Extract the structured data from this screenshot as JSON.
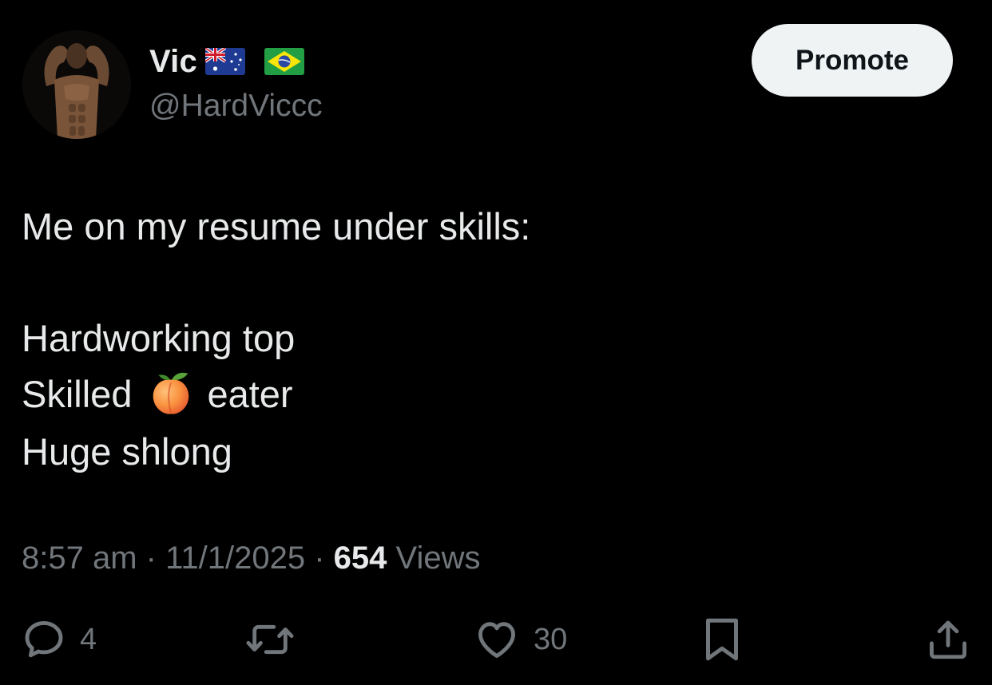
{
  "author": {
    "display_name": "Vic",
    "handle": "@HardViccc",
    "flags": [
      "australia-flag-icon",
      "brazil-flag-icon"
    ],
    "avatar": "profile-photo"
  },
  "promote_label": "Promote",
  "tweet": {
    "lines": [
      "Me on my resume under skills:",
      "Hardworking top",
      "Skilled",
      "eater",
      "Huge shlong"
    ],
    "inline_emoji": "peach-emoji-icon"
  },
  "meta": {
    "time": "8:57 am",
    "separator": "·",
    "date": "11/1/2025",
    "views_count": "654",
    "views_label": "Views"
  },
  "actions": {
    "replies": {
      "icon": "reply-icon",
      "count": "4"
    },
    "reposts": {
      "icon": "repost-icon",
      "count": ""
    },
    "likes": {
      "icon": "heart-icon",
      "count": "30"
    },
    "bookmark": {
      "icon": "bookmark-icon"
    },
    "share": {
      "icon": "share-icon"
    }
  },
  "colors": {
    "background": "#000000",
    "primary_text": "#e7e9ea",
    "secondary_text": "#71767b",
    "button_bg": "#eff3f4",
    "button_text": "#0f1419"
  }
}
